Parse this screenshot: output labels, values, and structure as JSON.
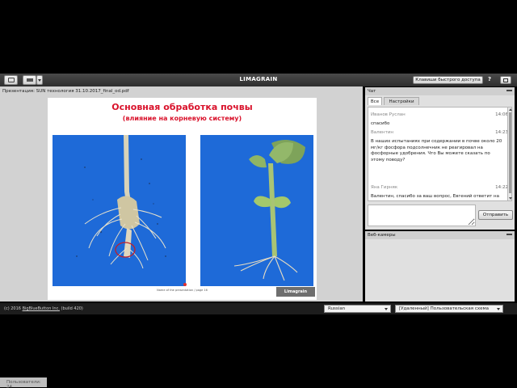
{
  "toolbar": {
    "title": "LIMAGRAIN",
    "shortcut_label": "Клавиши быстрого доступа",
    "help_label": "?"
  },
  "presentation": {
    "caption": "Презентация: SUN технология 31.10.2017_final_od.pdf",
    "slide_title": "Основная обработка почвы",
    "slide_subtitle": "(влияние на корневую систему)",
    "slide_footer": "Name of the presentation / page 16",
    "slide_logo": "Limagrain"
  },
  "users": {
    "label": "Пользователи: 24"
  },
  "chat": {
    "title": "Чат",
    "tabs": [
      {
        "label": "Все"
      },
      {
        "label": "Настройки"
      }
    ],
    "messages": [
      {
        "author": "Иванов Руслан",
        "time": "14:06",
        "text": "спасибо"
      },
      {
        "author": "Валентин",
        "time": "14:23",
        "text": "В наших испытаниях при содержании в почве около 20 мг/кг фосфора подсолнечник не реагировал на фосфорные удобрения. Что Вы можете сказать по этому поводу?"
      },
      {
        "author": "Яна Гирняк",
        "time": "14:22",
        "text": "Валентин, спасибо за ваш вопрос, Евгений ответит на вопросы в конце презентации"
      }
    ],
    "send_label": "Отправить"
  },
  "webcam": {
    "title": "Веб-камеры"
  },
  "status": {
    "copyright": "(c) 2016",
    "copyright_link": "BigBlueButton Inc.",
    "build": "(build 420)",
    "language": "Russian",
    "layout": "[Удаленный] Пользовательская схема"
  },
  "colors": {
    "slide_title": "#d9122b",
    "photo_background": "#1d68d6"
  }
}
